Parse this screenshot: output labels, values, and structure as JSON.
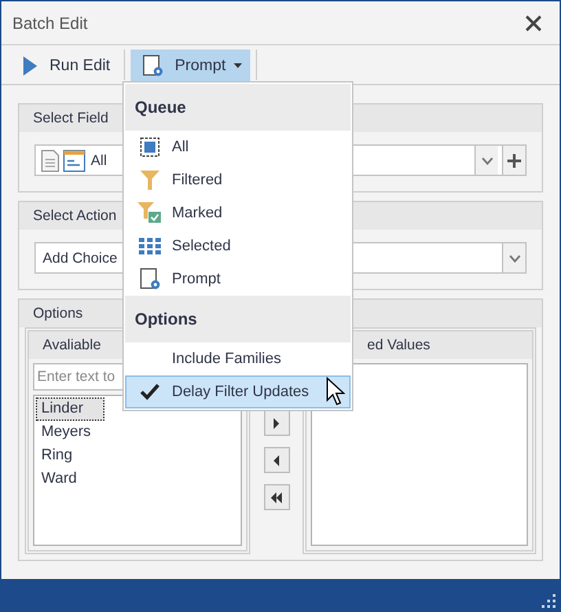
{
  "window": {
    "title": "Batch Edit"
  },
  "toolbar": [
    {
      "label": "Run Edit",
      "kind": "run",
      "selected": false
    },
    {
      "label": "Prompt",
      "kind": "dropdown",
      "selected": true
    }
  ],
  "select_field": {
    "header": "Select Field",
    "value": "All"
  },
  "select_action": {
    "header": "Select Action",
    "value": "Add Choice"
  },
  "options": {
    "header": "Options",
    "available": {
      "header": "Avaliable",
      "placeholder": "Enter text to",
      "items": [
        {
          "label": "Linder",
          "selected": true
        },
        {
          "label": "Meyers",
          "selected": false
        },
        {
          "label": "Ring",
          "selected": false
        },
        {
          "label": "Ward",
          "selected": false
        }
      ]
    },
    "selected_values": {
      "header": "ed Values"
    }
  },
  "menu": {
    "sections": [
      {
        "header": "Queue",
        "items": [
          {
            "label": "All",
            "kind": "all",
            "checked": false,
            "selected": false
          },
          {
            "label": "Filtered",
            "kind": "filtered",
            "checked": false,
            "selected": false
          },
          {
            "label": "Marked",
            "kind": "marked",
            "checked": false,
            "selected": false
          },
          {
            "label": "Selected",
            "kind": "grid",
            "checked": false,
            "selected": false
          },
          {
            "label": "Prompt",
            "kind": "prompt",
            "checked": false,
            "selected": false
          }
        ]
      },
      {
        "header": "Options",
        "items": [
          {
            "label": "Include Families",
            "kind": "plain",
            "checked": false,
            "selected": false
          },
          {
            "label": "Delay Filter Updates",
            "kind": "plain",
            "checked": true,
            "selected": true
          }
        ]
      }
    ]
  }
}
